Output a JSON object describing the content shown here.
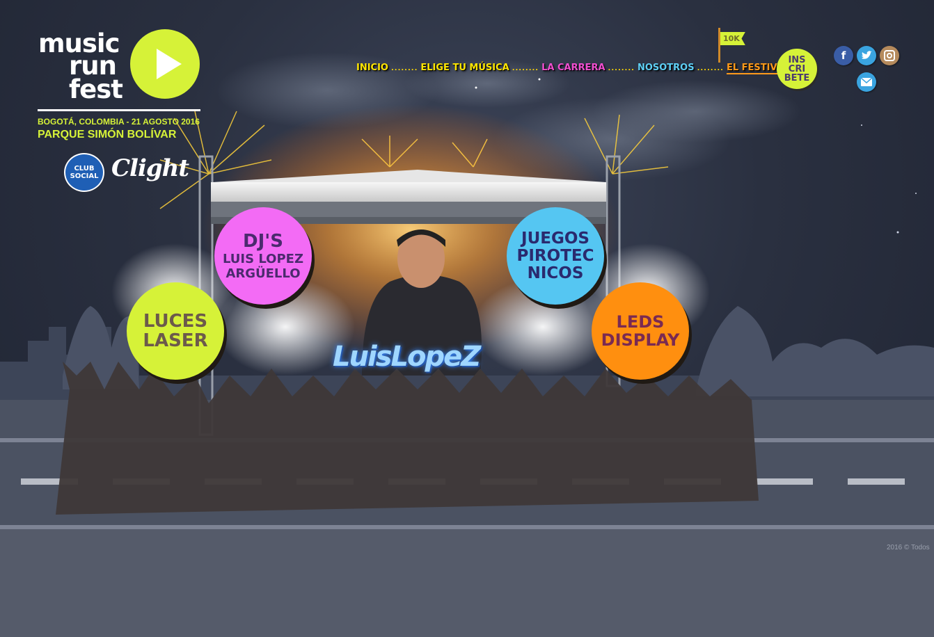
{
  "brand": {
    "logo_words": [
      "music",
      "run",
      "fest"
    ],
    "location_line": "BOGOTÁ, COLOMBIA - 21 AGOSTO 2016",
    "park_line": "PARQUE SIMÓN BOLÍVAR",
    "sponsors": [
      "CLUB SOCIAL",
      "Clight"
    ]
  },
  "nav": {
    "items": [
      {
        "label": "INICIO",
        "color": "#ffe600"
      },
      {
        "label": "ELIGE TU MÚSICA",
        "color": "#ffe600"
      },
      {
        "label": "LA CARRERA",
        "color": "#f04fd0"
      },
      {
        "label": "NOSOTROS",
        "color": "#5ecff5"
      },
      {
        "label": "EL FESTIVAL",
        "color": "#ff9a1a"
      }
    ],
    "separator": "........",
    "flag_label": "10K"
  },
  "cta": {
    "lines": [
      "INS",
      "CRI",
      "BETE"
    ]
  },
  "social": [
    "facebook-icon",
    "twitter-icon",
    "instagram-icon",
    "mail-icon"
  ],
  "bubbles": {
    "djs": {
      "lines": [
        "DJ'S",
        "LUIS LOPEZ",
        "ARGÜELLO"
      ],
      "color": "#f36bf5"
    },
    "juegos": {
      "lines": [
        "JUEGOS",
        "PIROTEC",
        "NICOS"
      ],
      "color": "#55c6f2"
    },
    "luces": {
      "lines": [
        "LUCES",
        "LASER"
      ],
      "color": "#d6f238"
    },
    "leds": {
      "lines": [
        "LEDS",
        "DISPLAY"
      ],
      "color": "#ff8f0f"
    }
  },
  "dj_logo": "LuisLopeZ",
  "footer": {
    "copyright": "2016 © Todos"
  }
}
